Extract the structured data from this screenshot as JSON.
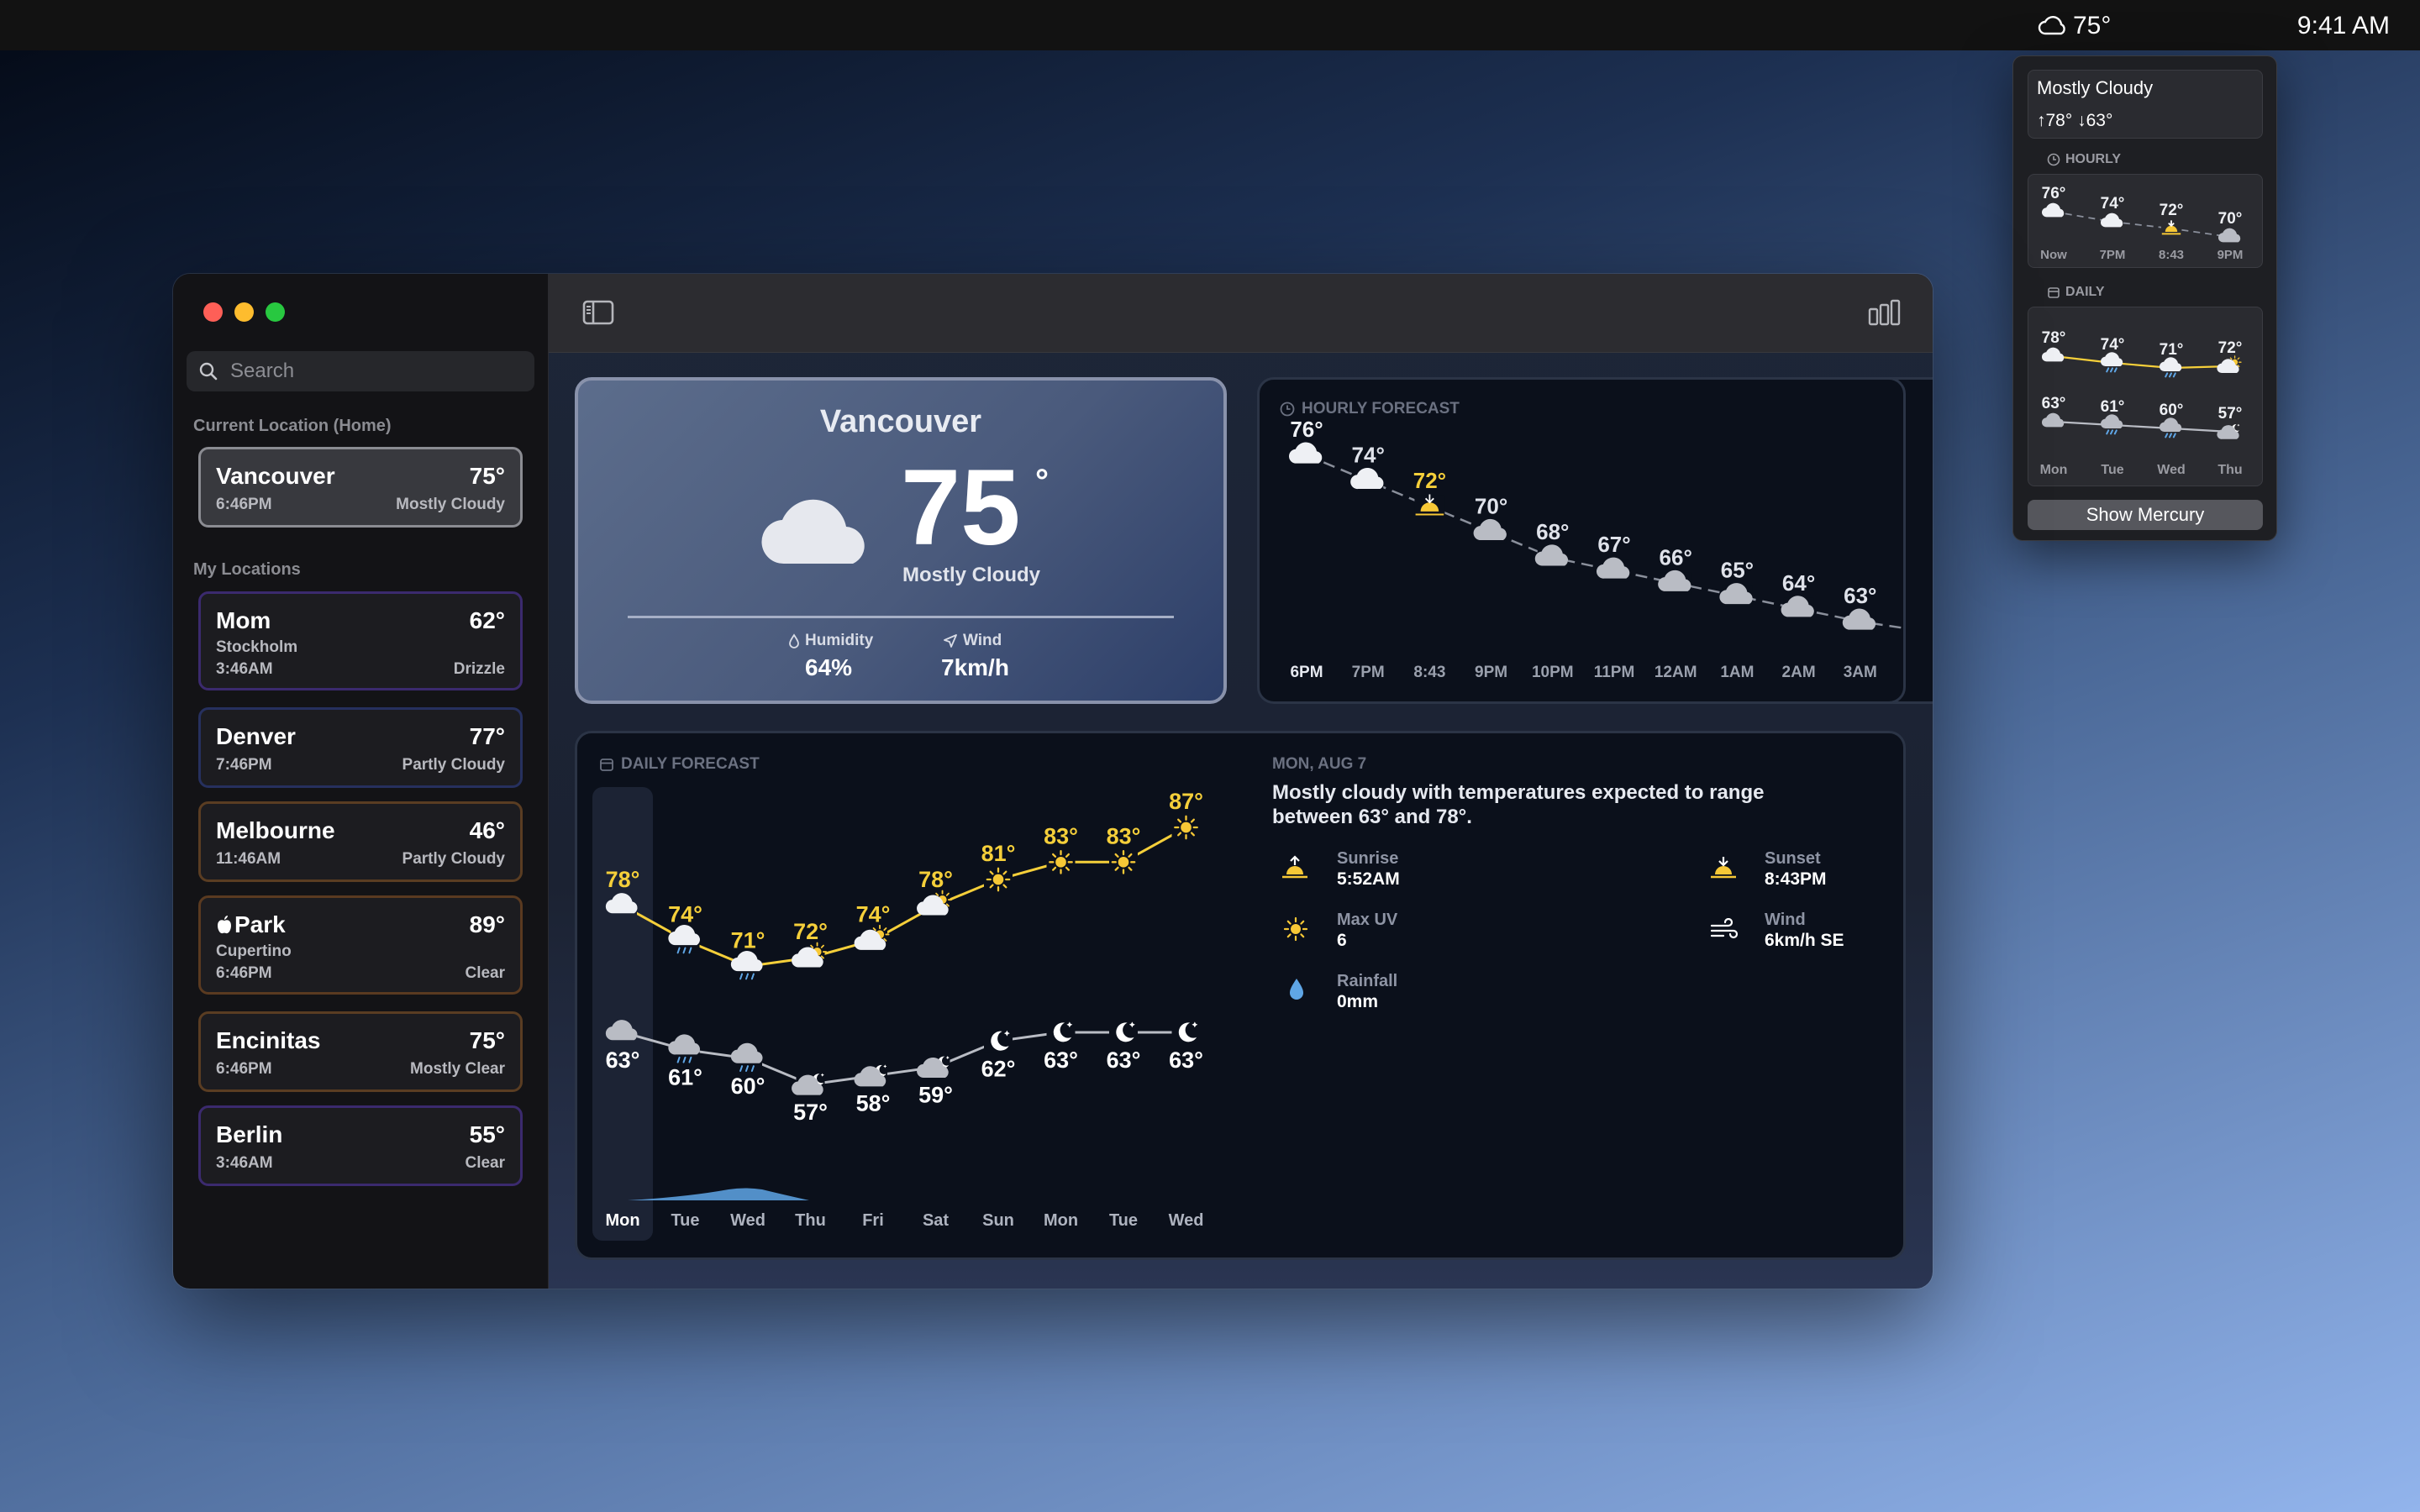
{
  "menubar": {
    "weather_temp": "75°",
    "clock": "9:41 AM"
  },
  "popover": {
    "condition": "Mostly Cloudy",
    "high_low": "↑78° ↓63°",
    "hourly_label": "HOURLY",
    "hourly": [
      {
        "temp": "76°",
        "time": "Now",
        "icon": "cloud-icon"
      },
      {
        "temp": "74°",
        "time": "7PM",
        "icon": "cloud-icon"
      },
      {
        "temp": "72°",
        "time": "8:43",
        "icon": "sunset-icon"
      },
      {
        "temp": "70°",
        "time": "9PM",
        "icon": "cloud-icon"
      }
    ],
    "daily_label": "DAILY",
    "daily": [
      {
        "day": "Mon",
        "high": "78°",
        "low": "63°"
      },
      {
        "day": "Tue",
        "high": "74°",
        "low": "61°"
      },
      {
        "day": "Wed",
        "high": "71°",
        "low": "60°"
      },
      {
        "day": "Thu",
        "high": "72°",
        "low": "57°"
      }
    ],
    "button": "Show Mercury"
  },
  "sidebar": {
    "search_placeholder": "Search",
    "current_section": "Current Location (Home)",
    "my_section": "My Locations",
    "current": {
      "name": "Vancouver",
      "time": "6:46PM",
      "temp": "75°",
      "condition": "Mostly Cloudy"
    },
    "locations": [
      {
        "name": "Mom",
        "sub": "Stockholm",
        "time": "3:46AM",
        "temp": "62°",
        "condition": "Drizzle",
        "accent": "#3b2a6e"
      },
      {
        "name": "Denver",
        "sub": "",
        "time": "7:46PM",
        "temp": "77°",
        "condition": "Partly Cloudy",
        "accent": "#26305e"
      },
      {
        "name": "Melbourne",
        "sub": "",
        "time": "11:46AM",
        "temp": "46°",
        "condition": "Partly Cloudy",
        "accent": "#5a3d22"
      },
      {
        "name": "Park",
        "sub": "Cupertino",
        "time": "6:46PM",
        "temp": "89°",
        "condition": "Clear",
        "accent": "#5a3a20"
      },
      {
        "name": "Encinitas",
        "sub": "",
        "time": "6:46PM",
        "temp": "75°",
        "condition": "Mostly Clear",
        "accent": "#5a3d22"
      },
      {
        "name": "Berlin",
        "sub": "",
        "time": "3:46AM",
        "temp": "55°",
        "condition": "Clear",
        "accent": "#3b2a6e"
      }
    ]
  },
  "current": {
    "city": "Vancouver",
    "temp": "75",
    "degree": "°",
    "condition": "Mostly Cloudy",
    "humidity_label": "Humidity",
    "humidity": "64%",
    "wind_label": "Wind",
    "wind": "7km/h"
  },
  "hourly": {
    "title": "HOURLY FORECAST",
    "points": [
      {
        "time": "6PM",
        "temp": 76,
        "label": "76°",
        "icon": "cloud-icon"
      },
      {
        "time": "7PM",
        "temp": 74,
        "label": "74°",
        "icon": "cloud-icon"
      },
      {
        "time": "8:43",
        "temp": 72,
        "label": "72°",
        "icon": "sunset-icon"
      },
      {
        "time": "9PM",
        "temp": 70,
        "label": "70°",
        "icon": "cloud-icon"
      },
      {
        "time": "10PM",
        "temp": 68,
        "label": "68°",
        "icon": "cloud-icon"
      },
      {
        "time": "11PM",
        "temp": 67,
        "label": "67°",
        "icon": "cloud-icon"
      },
      {
        "time": "12AM",
        "temp": 66,
        "label": "66°",
        "icon": "cloud-icon"
      },
      {
        "time": "1AM",
        "temp": 65,
        "label": "65°",
        "icon": "cloud-icon"
      },
      {
        "time": "2AM",
        "temp": 64,
        "label": "64°",
        "icon": "cloud-icon"
      },
      {
        "time": "3AM",
        "temp": 63,
        "label": "63°",
        "icon": "cloud-icon"
      }
    ]
  },
  "daily": {
    "title": "DAILY FORECAST",
    "days": [
      "Mon",
      "Tue",
      "Wed",
      "Thu",
      "Fri",
      "Sat",
      "Sun",
      "Mon",
      "Tue",
      "Wed"
    ],
    "highs": [
      78,
      74,
      71,
      72,
      74,
      78,
      81,
      83,
      83,
      87
    ],
    "lows": [
      63,
      61,
      60,
      57,
      58,
      59,
      62,
      63,
      63,
      63
    ],
    "high_icons": [
      "cloud-icon",
      "rain-icon",
      "rain-icon",
      "partly-sunny-icon",
      "partly-sunny-icon",
      "partly-sunny-icon",
      "sun-icon",
      "sun-icon",
      "sun-icon",
      "sun-icon"
    ],
    "low_icons": [
      "cloud-icon",
      "rain-icon",
      "rain-icon",
      "partly-moon-icon",
      "partly-moon-icon",
      "partly-moon-icon",
      "moon-icon",
      "moon-icon",
      "moon-icon",
      "moon-icon"
    ],
    "date": "MON, AUG 7",
    "summary": "Mostly cloudy with temperatures expected to range between 63° and 78°.",
    "details": {
      "sunrise_label": "Sunrise",
      "sunrise": "5:52AM",
      "sunset_label": "Sunset",
      "sunset": "8:43PM",
      "uv_label": "Max UV",
      "uv": "6",
      "wind_label": "Wind",
      "wind": "6km/h SE",
      "rain_label": "Rainfall",
      "rain": "0mm"
    }
  },
  "colors": {
    "accent_yellow": "#f5cf3a",
    "sun": "#f7c836",
    "rain": "#5fa6e6"
  }
}
